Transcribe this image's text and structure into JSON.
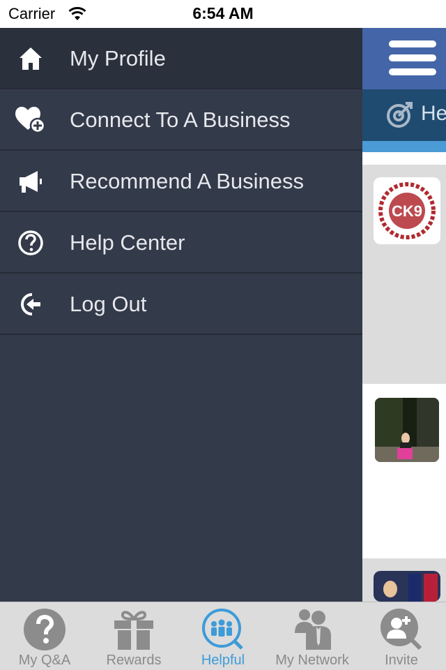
{
  "status_bar": {
    "carrier": "Carrier",
    "time": "6:54 AM"
  },
  "drawer": {
    "items": [
      {
        "label": "My Profile",
        "icon": "home-icon"
      },
      {
        "label": "Connect To A Business",
        "icon": "heart-plus-icon"
      },
      {
        "label": "Recommend A Business",
        "icon": "megaphone-icon"
      },
      {
        "label": "Help Center",
        "icon": "question-circle-icon"
      },
      {
        "label": "Log Out",
        "icon": "logout-icon"
      }
    ]
  },
  "background": {
    "tab_label": "He",
    "logo_text": "CK9",
    "colors": {
      "header": "#4466a8",
      "tab_strip": "#1f4b70",
      "accent": "#4a9bd6"
    }
  },
  "tab_bar": {
    "tabs": [
      {
        "label": "My Q&A",
        "icon": "question-icon"
      },
      {
        "label": "Rewards",
        "icon": "gift-icon"
      },
      {
        "label": "Helpful",
        "icon": "people-icon",
        "selected": true
      },
      {
        "label": "My Network",
        "icon": "business-people-icon"
      },
      {
        "label": "Invite",
        "icon": "add-user-icon"
      }
    ],
    "colors": {
      "selected": "#3d9bd8",
      "unselected": "#8a8a8a"
    }
  }
}
